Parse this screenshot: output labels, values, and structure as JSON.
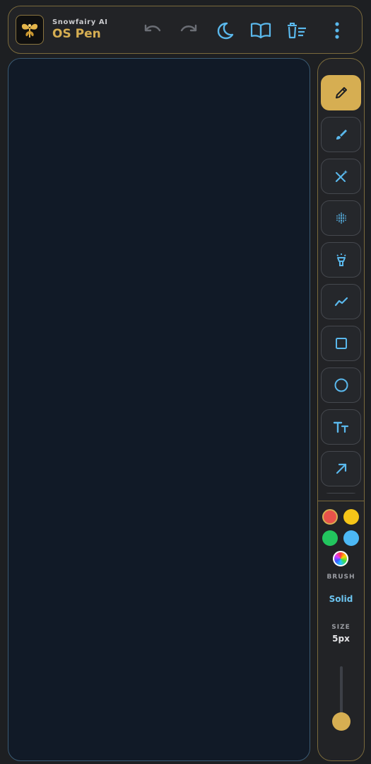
{
  "header": {
    "brand_sub": "Snowfairy AI",
    "brand_title": "OS Pen",
    "actions": [
      {
        "name": "undo-button",
        "icon": "undo-icon"
      },
      {
        "name": "redo-button",
        "icon": "redo-icon"
      },
      {
        "name": "dark-mode-button",
        "icon": "moon-icon"
      },
      {
        "name": "open-book-button",
        "icon": "book-open-icon"
      },
      {
        "name": "clear-button",
        "icon": "delete-list-icon"
      },
      {
        "name": "more-button",
        "icon": "more-vertical-icon"
      }
    ]
  },
  "tools": [
    {
      "name": "pen",
      "icon": "pencil-icon",
      "active": true
    },
    {
      "name": "brush",
      "icon": "brush-icon",
      "active": false
    },
    {
      "name": "magic-eraser",
      "icon": "wand-icon",
      "active": false
    },
    {
      "name": "spray",
      "icon": "spray-dots-icon",
      "active": false
    },
    {
      "name": "highlighter",
      "icon": "highlighter-icon",
      "active": false
    },
    {
      "name": "line",
      "icon": "polyline-icon",
      "active": false
    },
    {
      "name": "rectangle",
      "icon": "square-icon",
      "active": false
    },
    {
      "name": "circle",
      "icon": "circle-icon",
      "active": false
    },
    {
      "name": "text",
      "icon": "text-size-icon",
      "active": false
    },
    {
      "name": "arrow",
      "icon": "arrow-up-right-icon",
      "active": false
    }
  ],
  "colors": {
    "accent": "#d6ae52",
    "icon": "#5ab8ec",
    "swatches": [
      "#e8524a",
      "#f5c518",
      "#22c55e",
      "#4cb8f5"
    ],
    "selected_swatch": "#e8524a"
  },
  "brush": {
    "label": "BRUSH",
    "value": "Solid"
  },
  "size": {
    "label": "SIZE",
    "value": "5px",
    "level": 0.05
  }
}
